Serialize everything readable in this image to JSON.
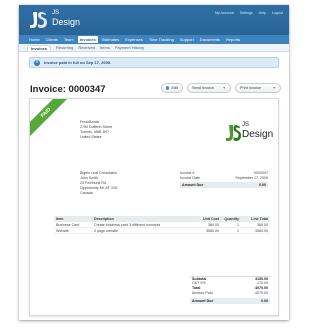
{
  "header": {
    "logo_small": "JS",
    "logo_big": "Design",
    "links": [
      "My Account",
      "Settings",
      "Help",
      "Logout"
    ]
  },
  "main_nav": [
    "Home",
    "Clients",
    "Team",
    "Invoices",
    "Estimates",
    "Expenses",
    "Time Tracking",
    "Support",
    "Documents",
    "Reports"
  ],
  "main_nav_active": "Invoices",
  "sub_nav": [
    "Invoices",
    "Recurring",
    "Received",
    "Items",
    "Payment History"
  ],
  "notice": {
    "icon": "info-icon",
    "text": "Invoice paid in full on Sep 17, 2009."
  },
  "page": {
    "title": "Invoice: 0000347",
    "edit_label": "Edit",
    "send_label": "Send Invoice",
    "print_label": "Print Invoice"
  },
  "invoice": {
    "ribbon": "PAID",
    "from": [
      "FreshBooks",
      "2750 Dufferin Street",
      "Toronto, M6B 3R7",
      "United States"
    ],
    "brand_small": "JS",
    "brand_big": "Design",
    "to": [
      "Bigelo Leaf Chocolates",
      "John Smith",
      "23 Fernhurst Rd",
      "Opportunity Mt, AF X2E",
      "Canada"
    ],
    "meta": {
      "invoice_no_label": "Invoice #",
      "invoice_no": "0000347",
      "date_label": "Invoice Date",
      "date": "September 17, 2009",
      "due_label": "Amount Due",
      "due": "0.00"
    },
    "table_headers": [
      "Item",
      "Description",
      "Unit Cost",
      "Quantity",
      "Line Total"
    ],
    "rows": [
      [
        "Business Card",
        "Create business card 3 different concepts",
        "380.00",
        "1",
        "380.00"
      ],
      [
        "Website",
        "3 page website",
        "3580.00",
        "1",
        "3580.00"
      ]
    ],
    "totals": {
      "subtotal_label": "Subtotal",
      "subtotal": "4150.00",
      "tax_label": "GST 5%",
      "tax": "170.00",
      "total_label": "Total",
      "total": "4070.00",
      "paid_label": "Amount Paid",
      "paid": "-4070.00",
      "due_label": "Amount Due",
      "due": "0.00"
    }
  },
  "colors": {
    "header": "#2a6496",
    "nav": "#3d84bf",
    "paid_ribbon": "#56a83b",
    "brand_green": "#4a9a2e"
  }
}
